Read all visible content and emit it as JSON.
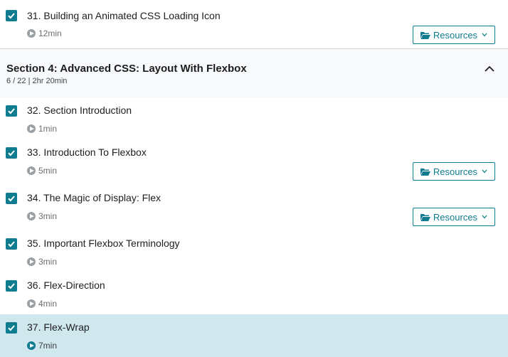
{
  "colors": {
    "accent": "#0f7c90",
    "active_bg": "#d1e7ee",
    "section_bg": "#f7f9fa"
  },
  "lectures_top": [
    {
      "title": "31. Building an Animated CSS Loading Icon",
      "duration": "12min",
      "completed": true,
      "resources_label": "Resources"
    }
  ],
  "section": {
    "title": "Section 4: Advanced CSS: Layout With Flexbox",
    "subtitle": "6 / 22 | 2hr 20min",
    "collapse_icon": "chevron-up-icon"
  },
  "lectures": [
    {
      "title": "32. Section Introduction",
      "duration": "1min",
      "completed": true
    },
    {
      "title": "33. Introduction To Flexbox",
      "duration": "5min",
      "completed": true,
      "resources_label": "Resources"
    },
    {
      "title": "34. The Magic of Display: Flex",
      "duration": "3min",
      "completed": true,
      "resources_label": "Resources"
    },
    {
      "title": "35. Important Flexbox Terminology",
      "duration": "3min",
      "completed": true
    },
    {
      "title": "36. Flex-Direction",
      "duration": "4min",
      "completed": true
    },
    {
      "title": "37. Flex-Wrap",
      "duration": "7min",
      "completed": true,
      "active": true
    }
  ]
}
